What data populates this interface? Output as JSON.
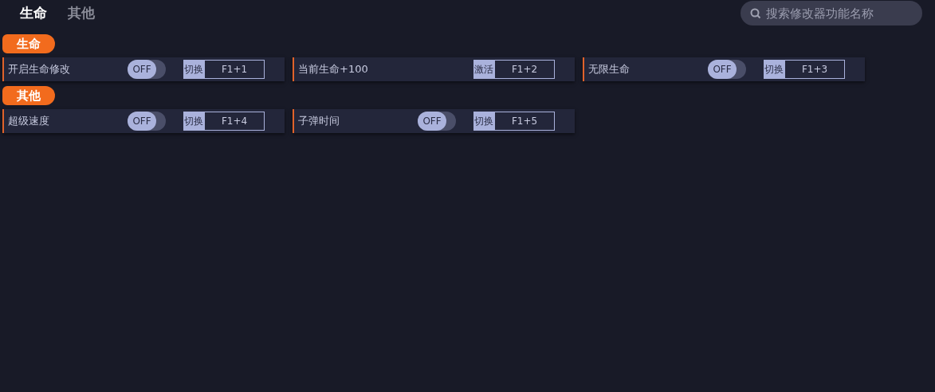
{
  "tabs": [
    {
      "label": "生命",
      "selected": true
    },
    {
      "label": "其他",
      "selected": false
    }
  ],
  "search": {
    "placeholder": "搜索修改器功能名称"
  },
  "sections": [
    {
      "title": "生命",
      "items": [
        {
          "kind": "toggle",
          "name": "开启生命修改",
          "toggle": {
            "label": "OFF",
            "on": false
          },
          "action": "切换",
          "hotkey": "F1+1"
        },
        {
          "kind": "button",
          "name": "当前生命+100",
          "action": "激活",
          "hotkey": "F1+2"
        },
        {
          "kind": "toggle",
          "name": "无限生命",
          "toggle": {
            "label": "OFF",
            "on": false
          },
          "action": "切换",
          "hotkey": "F1+3"
        }
      ]
    },
    {
      "title": "其他",
      "items": [
        {
          "kind": "toggle",
          "name": "超级速度",
          "toggle": {
            "label": "OFF",
            "on": false
          },
          "action": "切换",
          "hotkey": "F1+4"
        },
        {
          "kind": "toggle",
          "name": "子弹时间",
          "toggle": {
            "label": "OFF",
            "on": false
          },
          "action": "切换",
          "hotkey": "F1+5"
        }
      ]
    }
  ]
}
